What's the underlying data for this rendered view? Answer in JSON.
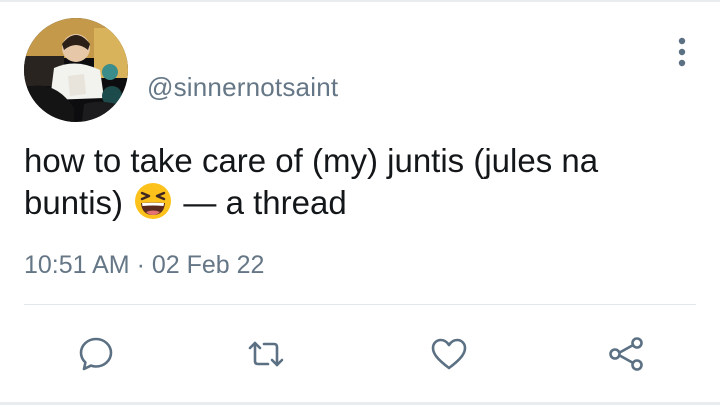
{
  "tweet": {
    "handle": "@sinnernotsaint",
    "text_before_emoji": "how to take care of (my) juntis (jules na buntis)",
    "emoji": "laughing-face-emoji",
    "text_after_emoji": "— a thread",
    "timestamp": "10:51 AM · 02 Feb 22"
  },
  "actions": [
    {
      "name": "reply",
      "icon": "speech-bubble-icon"
    },
    {
      "name": "retweet",
      "icon": "retweet-icon"
    },
    {
      "name": "like",
      "icon": "heart-icon"
    },
    {
      "name": "share",
      "icon": "share-icon"
    }
  ],
  "colors": {
    "text": "#14171a",
    "secondary": "#657786",
    "icon": "#5b7083",
    "divider": "#e1e8ed",
    "emoji_face": "#fcc21b"
  }
}
